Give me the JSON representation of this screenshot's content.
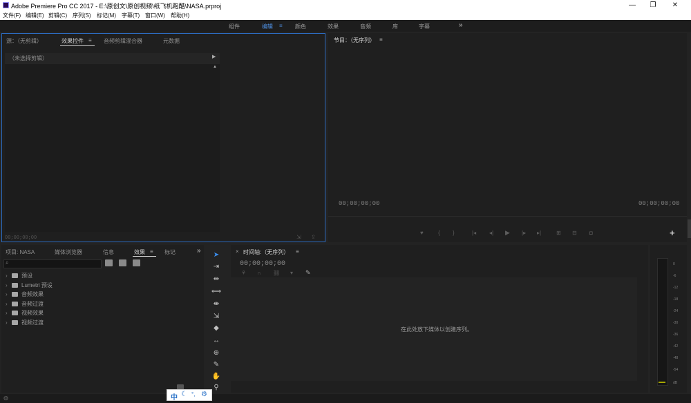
{
  "titlebar": {
    "title": "Adobe Premiere Pro CC 2017 - E:\\原创文\\原创视频\\纸飞机跑酷\\NASA.prproj",
    "minimize": "—",
    "restore": "❐",
    "close": "✕"
  },
  "menu": [
    "文件(F)",
    "编辑(E)",
    "剪辑(C)",
    "序列(S)",
    "标记(M)",
    "字幕(T)",
    "窗口(W)",
    "帮助(H)"
  ],
  "workspaces": {
    "items": [
      "组件",
      "编辑",
      "颜色",
      "效果",
      "音频",
      "库",
      "字幕"
    ],
    "active_index": 1,
    "menu_icon": "≡",
    "overflow": "»"
  },
  "source_panel": {
    "tabs": [
      "源：（无剪辑）",
      "效果控件",
      "音频剪辑混合器",
      "元数据"
    ],
    "active_index": 1,
    "no_clip": "（未选择剪辑）",
    "timecode": "00;00;00;00"
  },
  "program_panel": {
    "title": "节目：（无序列）",
    "timecode_left": "00;00;00;00",
    "timecode_right": "00;00;00;00",
    "add_button": "+"
  },
  "project_panel": {
    "tabs": [
      "项目: NASA",
      "媒体浏览器",
      "信息",
      "效果",
      "标记"
    ],
    "active_index": 3,
    "overflow": "»",
    "search_placeholder": "",
    "items": [
      "预设",
      "Lumetri 预设",
      "音频效果",
      "音频过渡",
      "视频效果",
      "视频过渡"
    ]
  },
  "tools": [
    "selection-tool",
    "track-select-tool",
    "ripple-edit-tool",
    "rolling-edit-tool",
    "rate-stretch-tool",
    "razor-tool",
    "slip-tool",
    "slide-tool",
    "pen-tool",
    "hand-tool",
    "zoom-tool"
  ],
  "timeline_panel": {
    "title": "时间轴:（无序列）",
    "close": "×",
    "menu": "≡",
    "timecode": "00;00;00;00",
    "empty_message": "在此处放下媒体以创建序列。"
  },
  "audio_meter": {
    "labels": [
      "0",
      "-6",
      "-12",
      "-18",
      "-24",
      "-30",
      "-36",
      "-42",
      "-48",
      "-54",
      "dB"
    ]
  },
  "ime_toolbar": {
    "label": "中",
    "moon": "☾",
    "punct": "°,",
    "gear": "⚙"
  },
  "colors": {
    "accent_blue": "#3b8ff0",
    "panel_bg": "#1f1f1f",
    "app_bg": "#232323"
  }
}
